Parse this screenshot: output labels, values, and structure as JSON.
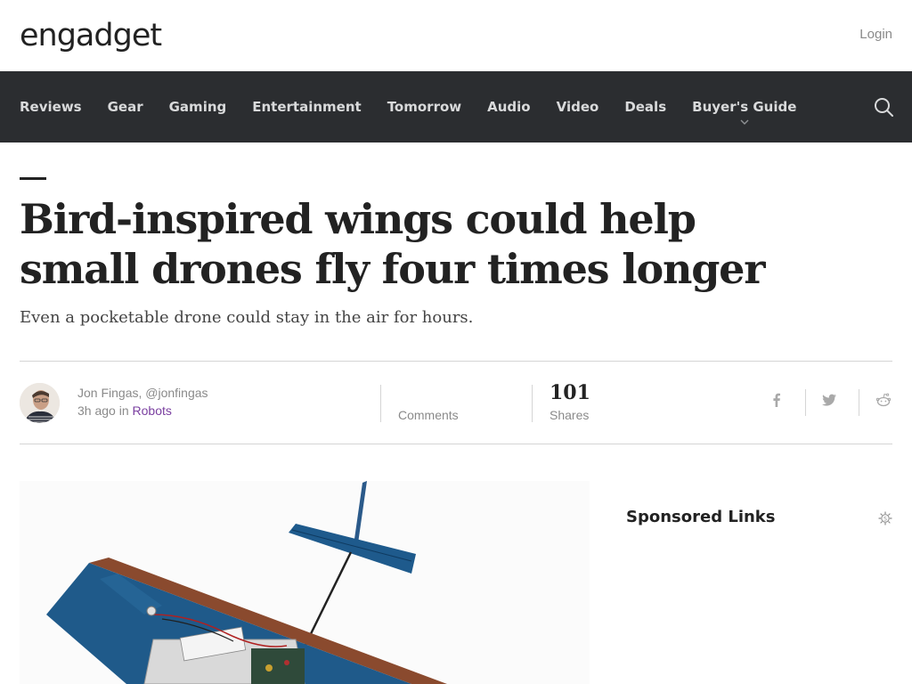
{
  "header": {
    "logo_text": "engadget",
    "login_label": "Login"
  },
  "nav": {
    "items": [
      {
        "label": "Reviews"
      },
      {
        "label": "Gear"
      },
      {
        "label": "Gaming"
      },
      {
        "label": "Entertainment"
      },
      {
        "label": "Tomorrow"
      },
      {
        "label": "Audio"
      },
      {
        "label": "Video"
      },
      {
        "label": "Deals"
      },
      {
        "label": "Buyer's Guide"
      }
    ],
    "search_icon": "search-icon",
    "dropdown_icon": "chevron-down-icon"
  },
  "article": {
    "title": "Bird-inspired wings could help small drones fly four times longer",
    "subtitle": "Even a pocketable drone could stay in the air for hours.",
    "author": "Jon Fingas, @jonfingas",
    "time": "3h ago",
    "in_label": "in",
    "category": "Robots",
    "comments_label": "Comments",
    "shares_count": "101",
    "shares_label": "Shares"
  },
  "social": {
    "icons": [
      "facebook-icon",
      "twitter-icon",
      "reddit-icon"
    ]
  },
  "sidebar": {
    "sponsored_title": "Sponsored Links",
    "sponsored_icon": "sponsor-badge-icon"
  },
  "colors": {
    "nav_bg": "#2b2d30",
    "nav_text": "#d9dadb",
    "category_link": "#7a3fa0",
    "muted_text": "#8a8a8a"
  }
}
